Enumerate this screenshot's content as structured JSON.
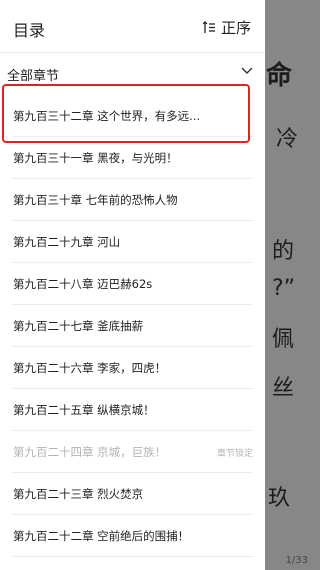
{
  "reader": {
    "fragments": [
      "命",
      "冷",
      "的",
      "?”",
      "佩",
      "丝",
      "玖"
    ],
    "page_indicator": "1/33"
  },
  "drawer": {
    "title": "目录",
    "sort_label": "正序",
    "section_label": "全部章节",
    "chapters": [
      {
        "title": "第九百三十二章 这个世界，有多远...",
        "locked": false,
        "current": true
      },
      {
        "title": "第九百三十一章 黑夜，与光明！",
        "locked": false
      },
      {
        "title": "第九百三十章 七年前的恐怖人物",
        "locked": false
      },
      {
        "title": "第九百二十九章 河山",
        "locked": false
      },
      {
        "title": "第九百二十八章 迈巴赫62s",
        "locked": false
      },
      {
        "title": "第九百二十七章 釜底抽薪",
        "locked": false
      },
      {
        "title": "第九百二十六章 李家，四虎！",
        "locked": false
      },
      {
        "title": "第九百二十五章 纵横京城！",
        "locked": false
      },
      {
        "title": "第九百二十四章 京城，巨族！",
        "locked": true,
        "lock_label": "章节锁定"
      },
      {
        "title": "第九百二十三章 烈火焚京",
        "locked": false
      },
      {
        "title": "第九百二十二章 空前绝后的围捕！",
        "locked": false
      }
    ]
  },
  "colors": {
    "highlight": "#e02424",
    "locked_text": "#b5b5b5"
  }
}
